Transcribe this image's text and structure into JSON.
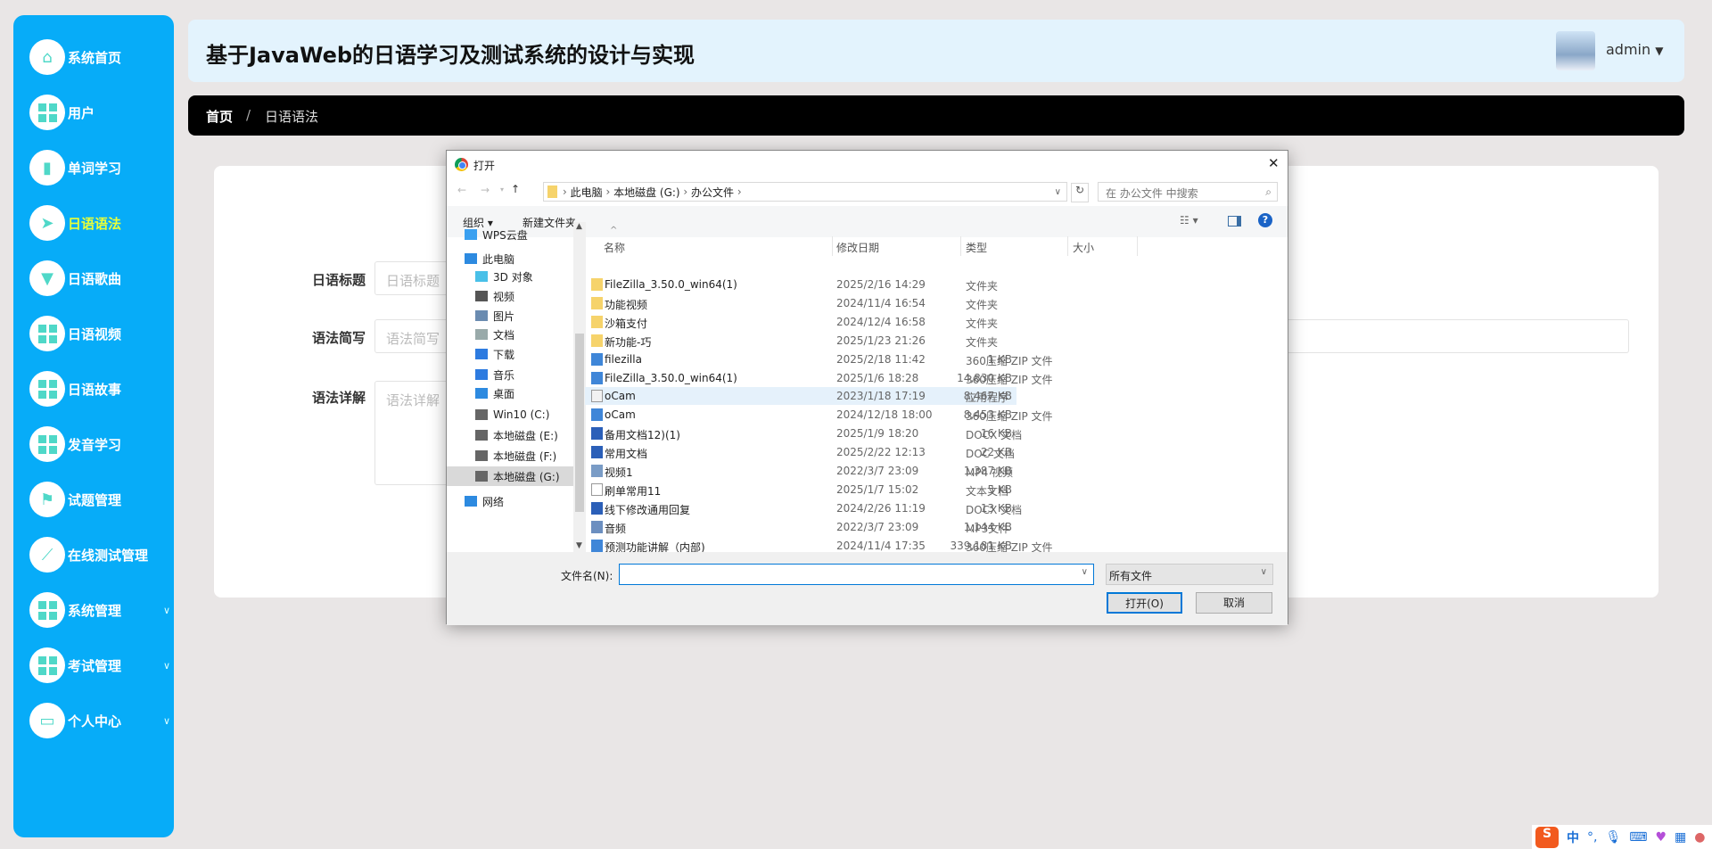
{
  "sidebar": {
    "items": [
      {
        "label": "系统首页",
        "icon": "home-icon"
      },
      {
        "label": "用户",
        "icon": "grid-icon"
      },
      {
        "label": "单词学习",
        "icon": "book-icon"
      },
      {
        "label": "日语语法",
        "icon": "paper-plane-icon",
        "active": true
      },
      {
        "label": "日语歌曲",
        "icon": "brush-icon"
      },
      {
        "label": "日语视频",
        "icon": "grid-icon"
      },
      {
        "label": "日语故事",
        "icon": "grid-icon"
      },
      {
        "label": "发音学习",
        "icon": "grid-icon"
      },
      {
        "label": "试题管理",
        "icon": "flag-icon"
      },
      {
        "label": "在线测试管理",
        "icon": "chart-icon"
      },
      {
        "label": "系统管理",
        "icon": "grid-icon",
        "chevron": true
      },
      {
        "label": "考试管理",
        "icon": "grid-icon",
        "chevron": true
      },
      {
        "label": "个人中心",
        "icon": "wallet-icon",
        "chevron": true
      }
    ]
  },
  "header": {
    "title": "基于JavaWeb的日语学习及测试系统的设计与实现",
    "user": "admin"
  },
  "breadcrumb": {
    "home": "首页",
    "sep": "/",
    "current": "日语语法"
  },
  "form": {
    "title_label": "日语标题",
    "title_placeholder": "日语标题",
    "brief_label": "语法简写",
    "brief_placeholder": "语法简写",
    "detail_label": "语法详解",
    "detail_placeholder": "语法详解"
  },
  "dialog": {
    "title": "打开",
    "path": [
      "此电脑",
      "本地磁盘 (G:)",
      "办公文件"
    ],
    "search_placeholder": "在 办公文件 中搜索",
    "organize": "组织 ▾",
    "new_folder": "新建文件夹",
    "columns": {
      "name": "名称",
      "date": "修改日期",
      "type": "类型",
      "size": "大小"
    },
    "nav": [
      {
        "label": "WPS云盘",
        "icon": "cloud-icon"
      },
      {
        "label": "此电脑",
        "icon": "computer-icon"
      },
      {
        "label": "3D 对象",
        "icon": "cube-icon"
      },
      {
        "label": "视频",
        "icon": "video-icon"
      },
      {
        "label": "图片",
        "icon": "picture-icon"
      },
      {
        "label": "文档",
        "icon": "document-icon"
      },
      {
        "label": "下载",
        "icon": "download-icon"
      },
      {
        "label": "音乐",
        "icon": "music-icon"
      },
      {
        "label": "桌面",
        "icon": "desktop-icon"
      },
      {
        "label": "Win10 (C:)",
        "icon": "drive-icon"
      },
      {
        "label": "本地磁盘 (E:)",
        "icon": "drive-icon"
      },
      {
        "label": "本地磁盘 (F:)",
        "icon": "drive-icon"
      },
      {
        "label": "本地磁盘 (G:)",
        "icon": "drive-icon",
        "selected": true
      },
      {
        "label": "网络",
        "icon": "network-icon"
      }
    ],
    "files": [
      {
        "name": "FileZilla_3.50.0_win64(1)",
        "date": "2025/2/16 14:29",
        "type": "文件夹",
        "size": "",
        "icon": "folder"
      },
      {
        "name": "功能视频",
        "date": "2024/11/4 16:54",
        "type": "文件夹",
        "size": "",
        "icon": "folder"
      },
      {
        "name": "沙箱支付",
        "date": "2024/12/4 16:58",
        "type": "文件夹",
        "size": "",
        "icon": "folder"
      },
      {
        "name": "新功能-巧",
        "date": "2025/1/23 21:26",
        "type": "文件夹",
        "size": "",
        "icon": "folder"
      },
      {
        "name": "filezilla",
        "date": "2025/2/18 11:42",
        "type": "360压缩 ZIP 文件",
        "size": "1 KB",
        "icon": "zip"
      },
      {
        "name": "FileZilla_3.50.0_win64(1)",
        "date": "2025/1/6 18:28",
        "type": "360压缩 ZIP 文件",
        "size": "14,830 KB",
        "icon": "zip"
      },
      {
        "name": "oCam",
        "date": "2023/1/18 17:19",
        "type": "应用程序",
        "size": "8,467 KB",
        "icon": "app",
        "hover": true
      },
      {
        "name": "oCam",
        "date": "2024/12/18 18:00",
        "type": "360压缩 ZIP 文件",
        "size": "8,453 KB",
        "icon": "zip"
      },
      {
        "name": "备用文档12)(1)",
        "date": "2025/1/9 18:20",
        "type": "DOCX 文档",
        "size": "16 KB",
        "icon": "word"
      },
      {
        "name": "常用文档",
        "date": "2025/2/22 12:13",
        "type": "DOC 文档",
        "size": "22 KB",
        "icon": "word"
      },
      {
        "name": "视频1",
        "date": "2022/3/7 23:09",
        "type": "MP4 视频",
        "size": "1,387 KB",
        "icon": "video"
      },
      {
        "name": "刷单常用11",
        "date": "2025/1/7 15:02",
        "type": "文本文档",
        "size": "5 KB",
        "icon": "text"
      },
      {
        "name": "线下修改通用回复",
        "date": "2024/2/26 11:19",
        "type": "DOCX 文档",
        "size": "13 KB",
        "icon": "word"
      },
      {
        "name": "音频",
        "date": "2022/3/7 23:09",
        "type": "MP3文件",
        "size": "1,144 KB",
        "icon": "audio"
      },
      {
        "name": "预测功能讲解（内部)",
        "date": "2024/11/4 17:35",
        "type": "360压缩 ZIP 文件",
        "size": "339,181 KB",
        "icon": "zip"
      }
    ],
    "filename_label": "文件名(N):",
    "filename_value": "",
    "filter": "所有文件",
    "open": "打开(O)",
    "cancel": "取消"
  },
  "ime": {
    "lang": "中",
    "punct": "°,"
  },
  "colors": {
    "sidebar": "#07acf8",
    "active": "#e8ff3a",
    "header": "#e3f3fd"
  }
}
